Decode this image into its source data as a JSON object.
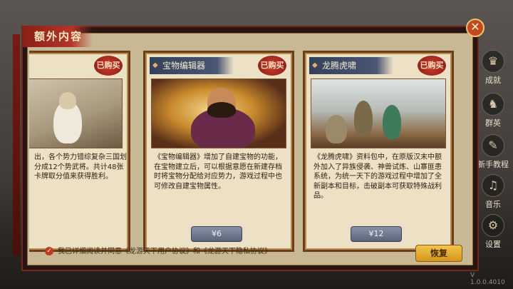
{
  "dialog": {
    "title": "额外内容",
    "close_symbol": "✕"
  },
  "cards": [
    {
      "title": "",
      "status": "已购买",
      "description": "出，各个势力错综复杂三国划分成12个势武将。共计48张卡牌取分值来获得胜利。",
      "price": ""
    },
    {
      "title": "宝物编辑器",
      "status": "已购买",
      "description": "《宝物编辑器》增加了自建宝物的功能，在宝物建立后，可以根据意愿在新建存档时将宝物分配给对应势力，游戏过程中也可修改自建宝物属性。",
      "price": "¥6"
    },
    {
      "title": "龙腾虎啸",
      "status": "已购买",
      "description": "《龙腾虎啸》资料包中，在原版汉末中额外加入了异族侵袭、神兽试炼、山寨匪患系统，为统一天下的游戏过程中增加了全新副本和目标，击破副本可获取特殊战利品。",
      "price": "¥12"
    }
  ],
  "footer": {
    "agreement_text": "我已详细阅读并同意《龙游天下用户协议》和《龙游天下隐私协议》",
    "checkbox_symbol": "✓",
    "restore_label": "恢复"
  },
  "side_menu": [
    {
      "label": "成就",
      "icon": "trophy-icon",
      "glyph": "♛"
    },
    {
      "label": "群英",
      "icon": "heroes-icon",
      "glyph": "♞"
    },
    {
      "label": "新手教程",
      "icon": "tutorial-icon",
      "glyph": "✎"
    },
    {
      "label": "音乐",
      "icon": "music-icon",
      "glyph": "♫"
    },
    {
      "label": "设置",
      "icon": "gear-icon",
      "glyph": "⚙"
    }
  ],
  "version": "V 1.0.0.4010"
}
